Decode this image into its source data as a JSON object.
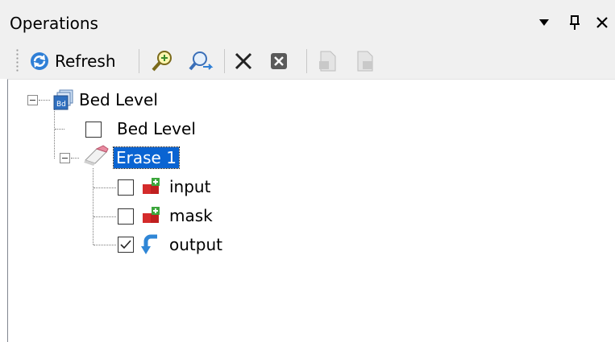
{
  "panel": {
    "title": "Operations",
    "controls": {
      "menu_glyph": "▾",
      "pin_glyph": "⊓",
      "close_glyph": "✕"
    }
  },
  "toolbar": {
    "refresh_label": "Refresh",
    "icons": [
      "refresh-icon",
      "zoom-in-icon",
      "zoom-out-icon",
      "delete-icon",
      "delete-all-icon",
      "import-icon",
      "export-icon"
    ]
  },
  "tree": {
    "root": {
      "label": "Bed Level",
      "icon": "dataset-stack-icon",
      "expanded": true
    },
    "children": [
      {
        "label": "Bed Level",
        "checked": false
      },
      {
        "label": "Erase 1",
        "icon": "eraser-icon",
        "expanded": true,
        "selected": true,
        "children": [
          {
            "label": "input",
            "checked": false,
            "icon": "input-blocks-icon"
          },
          {
            "label": "mask",
            "checked": false,
            "icon": "input-blocks-icon"
          },
          {
            "label": "output",
            "checked": true,
            "icon": "output-arrow-icon"
          }
        ]
      }
    ]
  },
  "colors": {
    "selection": "#0a64d2",
    "chrome": "#f0f0f0",
    "tree_background": "#ffffff"
  }
}
